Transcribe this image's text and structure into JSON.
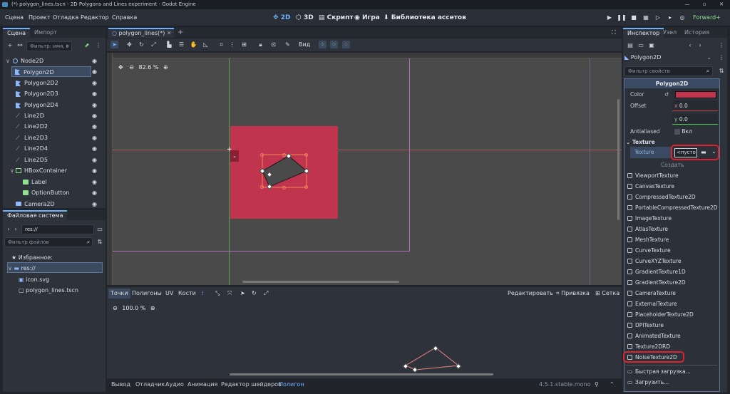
{
  "window": {
    "title": "(*) polygon_lines.tscn - 2D Polygons and Lines experiment - Godot Engine",
    "min": "—",
    "max": "▫",
    "close": "✕"
  },
  "menu": [
    "Сцена",
    "Проект",
    "Отладка",
    "Редактор",
    "Справка"
  ],
  "workspaces": {
    "w2d": "2D",
    "w3d": "3D",
    "script": "Скрипт",
    "game": "Игра",
    "assetlib": "Библиотека ассетов"
  },
  "renderer": "Forward+",
  "scene_dock": {
    "tab_scene": "Сцена",
    "tab_import": "Импорт",
    "filter_placeholder": "Фильтр: имя, t",
    "nodes": [
      {
        "label": "Node2D",
        "type": "node2d"
      },
      {
        "label": "Polygon2D",
        "type": "polygon",
        "selected": true
      },
      {
        "label": "Polygon2D2",
        "type": "polygon"
      },
      {
        "label": "Polygon2D3",
        "type": "polygon"
      },
      {
        "label": "Polygon2D4",
        "type": "polygon"
      },
      {
        "label": "Line2D",
        "type": "line"
      },
      {
        "label": "Line2D2",
        "type": "line"
      },
      {
        "label": "Line2D3",
        "type": "line"
      },
      {
        "label": "Line2D4",
        "type": "line"
      },
      {
        "label": "Line2D5",
        "type": "line"
      },
      {
        "label": "HBoxContainer",
        "type": "hbox"
      },
      {
        "label": "Label",
        "type": "label"
      },
      {
        "label": "OptionButton",
        "type": "option"
      },
      {
        "label": "Camera2D",
        "type": "camera"
      }
    ]
  },
  "filesystem": {
    "title": "Файловая система",
    "path": "res://",
    "filter_placeholder": "Фильтр файлов",
    "favorites": "Избранное:",
    "root": "res://",
    "files": [
      "icon.svg",
      "polygon_lines.tscn"
    ]
  },
  "editor_tab": "polygon_lines(*)",
  "toolbar": {
    "view": "Вид"
  },
  "viewport": {
    "zoom": "82.6 %"
  },
  "polygon_editor": {
    "tabs": [
      "Точки",
      "Полигоны",
      "UV",
      "Кости"
    ],
    "edit": "Редактировать",
    "snap": "Привязка",
    "grid": "Сетка",
    "zoom": "100.0 %"
  },
  "bottom_tabs": [
    "Вывод",
    "Отладчик",
    "Аудио",
    "Анимация",
    "Редактор шейдеров",
    "Полигон"
  ],
  "version": "4.5.1.stable.mono",
  "inspector": {
    "tab_inspector": "Инспектор",
    "tab_node": "Узел",
    "tab_history": "История",
    "node": "Polygon2D",
    "filter_placeholder": "Фильтр свойств",
    "header": "Polygon2D",
    "color_label": "Color",
    "color_value": "#c0344d",
    "offset_label": "Offset",
    "offset_x": "0.0",
    "offset_y": "0.0",
    "x": "x",
    "y": "y",
    "antialiased_label": "Antialiased",
    "antialiased_value": "Вкл",
    "texture_section": "Texture",
    "texture_label": "Texture",
    "texture_value": "<пусто",
    "create": "Создать",
    "textures": [
      "ViewportTexture",
      "CanvasTexture",
      "CompressedTexture2D",
      "PortableCompressedTexture2D",
      "ImageTexture",
      "AtlasTexture",
      "MeshTexture",
      "CurveTexture",
      "CurveXYZTexture",
      "GradientTexture1D",
      "GradientTexture2D",
      "CameraTexture",
      "ExternalTexture",
      "PlaceholderTexture2D",
      "DPITexture",
      "AnimatedTexture",
      "Texture2DRD",
      "NoiseTexture2D"
    ],
    "quickload": "Быстрая загрузка...",
    "load": "Загрузить..."
  },
  "colors": {
    "accent": "#6fb3ff",
    "polygon": "#c0344d",
    "highlight": "#e1212b"
  }
}
